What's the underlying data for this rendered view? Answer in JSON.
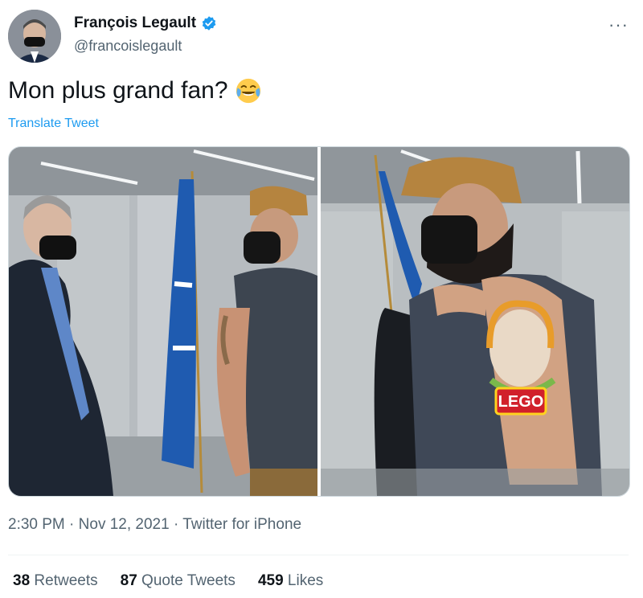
{
  "author": {
    "name": "François Legault",
    "handle": "@francoislegault",
    "verified_color": "#1d9bf0"
  },
  "menu": {
    "more_label": "···"
  },
  "tweet": {
    "text": "Mon plus grand fan?",
    "emoji": "face-with-tears-of-joy",
    "translate_label": "Translate Tweet"
  },
  "media": {
    "photos": [
      {
        "description_name": "photo-premier-and-fan"
      },
      {
        "description_name": "photo-fan-tattoo"
      }
    ],
    "tattoo_text": "LEGO"
  },
  "meta": {
    "time": "2:30 PM",
    "date": "Nov 12, 2021",
    "source": "Twitter for iPhone",
    "sep": "·"
  },
  "stats": {
    "retweets_count": "38",
    "retweets_label": "Retweets",
    "quotes_count": "87",
    "quotes_label": "Quote Tweets",
    "likes_count": "459",
    "likes_label": "Likes"
  }
}
